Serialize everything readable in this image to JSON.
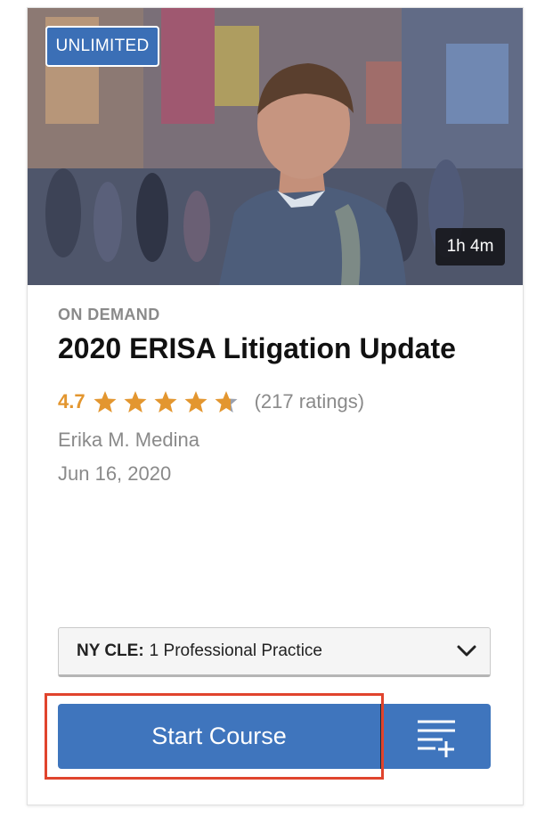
{
  "card": {
    "badge": "UNLIMITED",
    "duration": "1h 4m",
    "category": "ON DEMAND",
    "title": "2020 ERISA Litigation Update",
    "rating": {
      "value": "4.7",
      "stars": 4.7,
      "max_stars": 5,
      "count_text": "(217 ratings)"
    },
    "author": "Erika M. Medina",
    "date": "Jun 16, 2020",
    "credit": {
      "label": "NY CLE:",
      "value": "1 Professional Practice"
    },
    "start_button": "Start Course",
    "add_to_queue_icon": "playlist-add-icon"
  },
  "colors": {
    "accent_blue": "#3f75bd",
    "star_orange": "#e3962f",
    "highlight_red": "#e0442d",
    "muted_text": "#8a8a8a"
  }
}
